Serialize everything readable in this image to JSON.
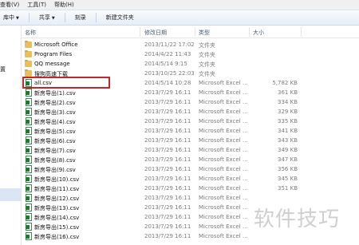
{
  "menubar": {
    "items": [
      "查看(V)",
      "工具(T)",
      "帮助(H)"
    ]
  },
  "toolbar": {
    "items": [
      "库中",
      "共享",
      "刻录",
      "新建文件夹"
    ]
  },
  "nav": {
    "label": "置"
  },
  "columns": {
    "name": "名称",
    "date": "修改日期",
    "type": "类型",
    "size": "大小"
  },
  "files": [
    {
      "name": "Microsoft Office",
      "date": "2013/11/22 17:02",
      "type": "文件夹",
      "size": "",
      "icon": "folder-icon"
    },
    {
      "name": "Program Files",
      "date": "2014/4/22 11:43",
      "type": "文件夹",
      "size": "",
      "icon": "folder-icon"
    },
    {
      "name": "QQ message",
      "date": "2014/5/14 9:15",
      "type": "文件夹",
      "size": "",
      "icon": "folder-icon"
    },
    {
      "name": "搜狗高速下载",
      "date": "2013/10/25 22:03",
      "type": "文件夹",
      "size": "",
      "icon": "folder-icon"
    },
    {
      "name": "all.csv",
      "date": "2014/5/14 10:28",
      "type": "Microsoft Excel ...",
      "size": "5,782 KB",
      "icon": "excel-csv-icon"
    },
    {
      "name": "新房导出(1).csv",
      "date": "2013/7/29 16:11",
      "type": "Microsoft Excel ...",
      "size": "361 KB",
      "icon": "excel-csv-icon"
    },
    {
      "name": "新房导出(2).csv",
      "date": "2013/7/29 16:11",
      "type": "Microsoft Excel ...",
      "size": "334 KB",
      "icon": "excel-csv-icon"
    },
    {
      "name": "新房导出(3).csv",
      "date": "2013/7/29 16:11",
      "type": "Microsoft Excel ...",
      "size": "329 KB",
      "icon": "excel-csv-icon"
    },
    {
      "name": "新房导出(4).csv",
      "date": "2013/7/29 16:11",
      "type": "Microsoft Excel ...",
      "size": "335 KB",
      "icon": "excel-csv-icon"
    },
    {
      "name": "新房导出(5).csv",
      "date": "2013/7/29 16:11",
      "type": "Microsoft Excel ...",
      "size": "341 KB",
      "icon": "excel-csv-icon"
    },
    {
      "name": "新房导出(6).csv",
      "date": "2013/7/29 16:11",
      "type": "Microsoft Excel ...",
      "size": "343 KB",
      "icon": "excel-csv-icon"
    },
    {
      "name": "新房导出(7).csv",
      "date": "2013/7/29 16:11",
      "type": "Microsoft Excel ...",
      "size": "349 KB",
      "icon": "excel-csv-icon"
    },
    {
      "name": "新房导出(8).csv",
      "date": "2013/7/29 16:11",
      "type": "Microsoft Excel ...",
      "size": "347 KB",
      "icon": "excel-csv-icon"
    },
    {
      "name": "新房导出(9).csv",
      "date": "2013/7/29 16:11",
      "type": "Microsoft Excel ...",
      "size": "356 KB",
      "icon": "excel-csv-icon"
    },
    {
      "name": "新房导出(10).csv",
      "date": "2013/7/29 16:11",
      "type": "Microsoft Excel ...",
      "size": "345 KB",
      "icon": "excel-csv-icon"
    },
    {
      "name": "新房导出(11).csv",
      "date": "2013/7/29 16:11",
      "type": "Microsoft Excel ...",
      "size": "351 KB",
      "icon": "excel-csv-icon"
    },
    {
      "name": "新房导出(12).csv",
      "date": "2013/7/29 16:11",
      "type": "Microsoft Excel ...",
      "size": "",
      "icon": "excel-csv-icon"
    },
    {
      "name": "新房导出(13).csv",
      "date": "2013/7/29 16:11",
      "type": "Microsoft Excel ...",
      "size": "",
      "icon": "excel-csv-icon"
    },
    {
      "name": "新房导出(14).csv",
      "date": "2013/7/29 16:11",
      "type": "Microsoft Excel ...",
      "size": "",
      "icon": "excel-csv-icon"
    },
    {
      "name": "新房导出(15).csv",
      "date": "2013/7/29 16:11",
      "type": "Microsoft Excel ...",
      "size": "",
      "icon": "excel-csv-icon"
    },
    {
      "name": "新房导出(16).csv",
      "date": "2013/7/29 16:11",
      "type": "Microsoft Excel ...",
      "size": "",
      "icon": "excel-csv-icon"
    }
  ],
  "watermark": "软件技巧",
  "colors": {
    "highlight": "#c1272d",
    "excel": "#1f7a35",
    "folder": "#e8bf5a"
  }
}
